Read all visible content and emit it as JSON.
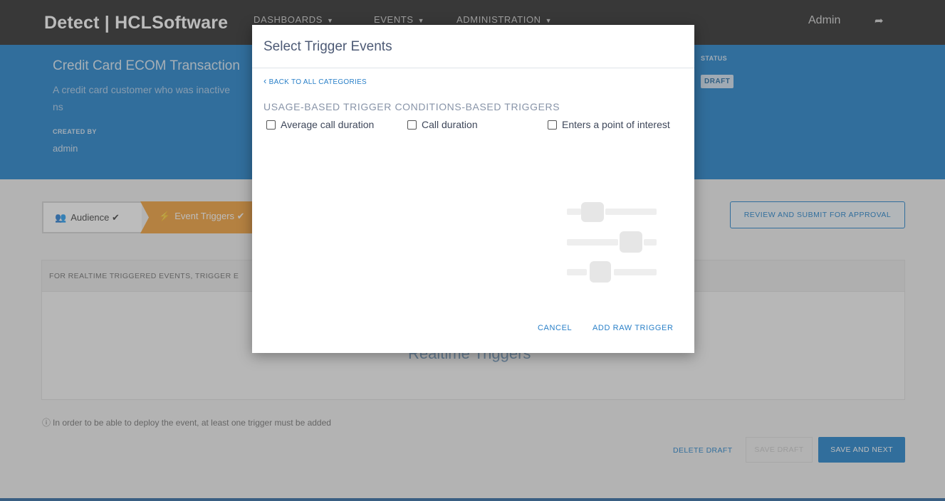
{
  "brand": {
    "name": "Detect | HCLSoftware"
  },
  "nav": {
    "dashboards": "DASHBOARDS",
    "events": "EVENTS",
    "administration": "ADMINISTRATION",
    "user": "Admin",
    "logout_icon": "sign-out-icon"
  },
  "event": {
    "title": "Credit Card ECOM Transaction",
    "description": "A credit card customer who was inactive",
    "description_cont": "ns",
    "created_by_label": "CREATED BY",
    "created_by": "admin",
    "status_label": "STATUS",
    "status": "DRAFT"
  },
  "steps": {
    "audience": "Audience",
    "event_triggers": "Event Triggers"
  },
  "review_button": "REVIEW AND SUBMIT FOR APPROVAL",
  "panel": {
    "header": "FOR REALTIME TRIGGERED EVENTS, TRIGGER E",
    "big_text": "Realtime Triggers"
  },
  "notice": "In order to be able to deploy the event, at least one trigger must be added",
  "footer": {
    "delete_draft": "DELETE DRAFT",
    "save_draft": "SAVE DRAFT",
    "save_next": "SAVE AND NEXT"
  },
  "modal": {
    "title": "Select Trigger Events",
    "back_link": "BACK TO ALL CATEGORIES",
    "category_header": "USAGE-BASED TRIGGER CONDITIONS-BASED TRIGGERS",
    "options": [
      {
        "label": "Average call duration",
        "checked": false
      },
      {
        "label": "Call duration",
        "checked": false
      },
      {
        "label": "Enters a point of interest",
        "checked": false
      }
    ],
    "cancel": "CANCEL",
    "add_raw_trigger": "ADD RAW TRIGGER"
  },
  "colors": {
    "accent": "#1079c9",
    "active_step": "#f29a2b",
    "topbar": "#1c1c1c"
  }
}
